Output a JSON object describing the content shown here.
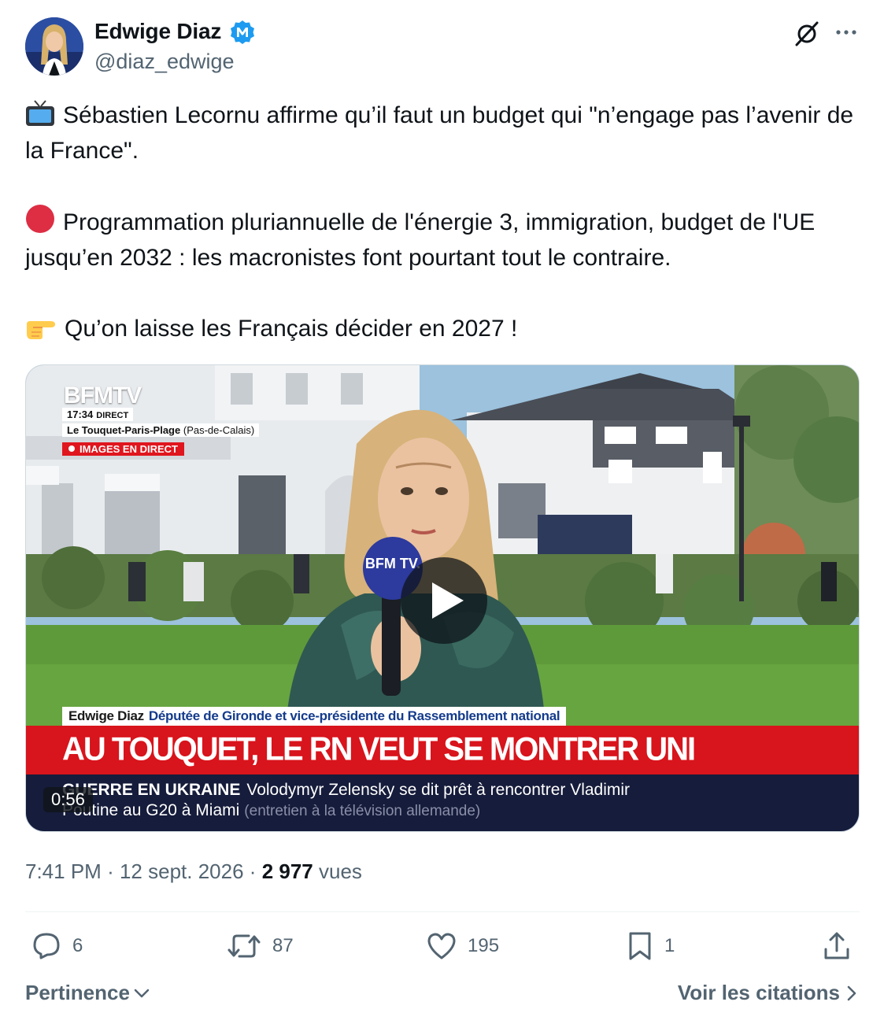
{
  "author": {
    "display_name": "Edwige Diaz",
    "handle": "@diaz_edwige",
    "badge_icon": "verified-m-badge-icon",
    "badge_color": "#1d9bf0"
  },
  "tweet": {
    "paragraphs": [
      {
        "emoji": "television-icon",
        "text": "Sébastien Lecornu affirme qu’il faut un budget qui \"n’engage pas l’avenir de la France\"."
      },
      {
        "emoji": "red-circle-icon",
        "text": "Programmation pluriannuelle de l'énergie 3, immigration, budget de l'UE jusqu’en 2032 : les macronistes font pourtant tout le contraire."
      },
      {
        "emoji": "pointing-hand-icon",
        "text": "Qu’on laisse les Français décider en 2027 !"
      }
    ]
  },
  "video": {
    "channel_logo": "BFMTV",
    "live_time": "17:34",
    "live_label": "DIRECT",
    "location": "Le Touquet-Paris-Plage",
    "location_region": "(Pas-de-Calais)",
    "live_images_label": "IMAGES EN DIRECT",
    "speaker_name": "Edwige Diaz",
    "speaker_role": "Députée de Gironde et vice-présidente du Rassemblement national",
    "headline": "AU TOUQUET, LE RN VEUT SE MONTRER UNI",
    "ticker_tag": "GUERRE EN UKRAINE",
    "ticker_line1": "Volodymyr Zelensky se dit prêt à rencontrer Vladimir",
    "ticker_line2": "Poutine au G20 à Miami",
    "ticker_line2_note": "(entretien à la télévision allemande)",
    "duration": "0:56",
    "mic_label": "BFM TV."
  },
  "meta": {
    "time": "7:41 PM",
    "sep1": "·",
    "date": "12 sept. 2026",
    "sep2": "·",
    "views_count": "2 977",
    "views_label": "vues"
  },
  "actions": {
    "replies": "6",
    "reposts": "87",
    "likes": "195",
    "bookmarks": "1"
  },
  "footer": {
    "sort_label": "Pertinence",
    "quotes_label": "Voir les citations"
  },
  "colors": {
    "text": "#0f1419",
    "secondary": "#536471",
    "bfm_red": "#d8141c",
    "ticker_bg": "#161c3b"
  }
}
